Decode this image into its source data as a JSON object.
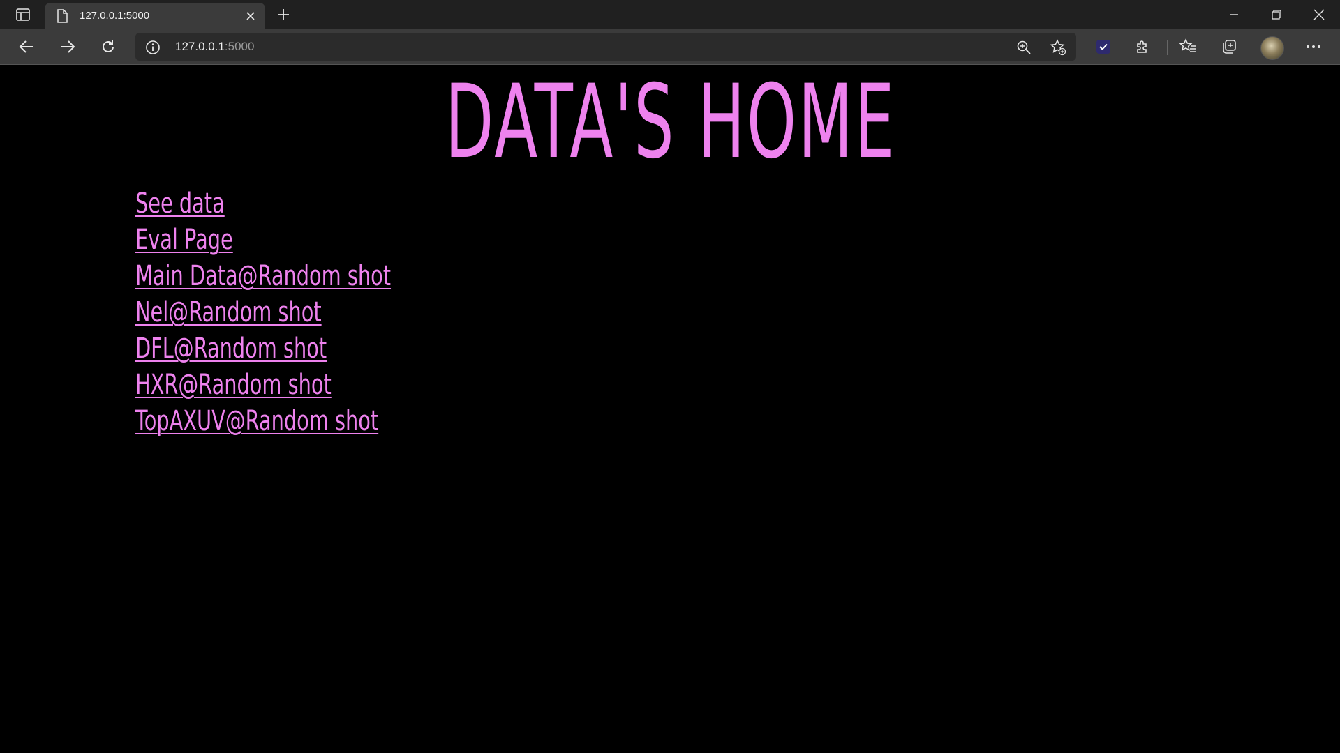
{
  "browser": {
    "tab": {
      "title": "127.0.0.1:5000",
      "favicon": "page-icon"
    },
    "address_bar": {
      "host": "127.0.0.1",
      "port": ":5000"
    },
    "icons": {
      "tab_actions": "tab-actions-icon",
      "new_tab": "plus-icon",
      "back": "arrow-left-icon",
      "forward": "arrow-right-icon",
      "reload": "reload-icon",
      "site_info": "info-icon",
      "zoom": "zoom-icon",
      "add_favorite": "star-add-icon",
      "extension_check": "checkmark-extension-icon",
      "extensions": "puzzle-icon",
      "favorites": "favorites-icon",
      "collections": "collections-icon",
      "more": "ellipsis-icon",
      "minimize": "minimize-icon",
      "restore": "restore-icon",
      "close": "close-icon"
    }
  },
  "page": {
    "title": "DATA'S HOME",
    "links": [
      {
        "label": "See data"
      },
      {
        "label": "Eval Page"
      },
      {
        "label": "Main Data@Random shot"
      },
      {
        "label": "Nel@Random shot"
      },
      {
        "label": "DFL@Random shot"
      },
      {
        "label": "HXR@Random shot"
      },
      {
        "label": "TopAXUV@Random shot"
      }
    ]
  },
  "colors": {
    "page_background": "#000000",
    "accent_text": "#ee82ee",
    "chrome_background": "#202020",
    "toolbar_background": "#3b3b3b"
  }
}
